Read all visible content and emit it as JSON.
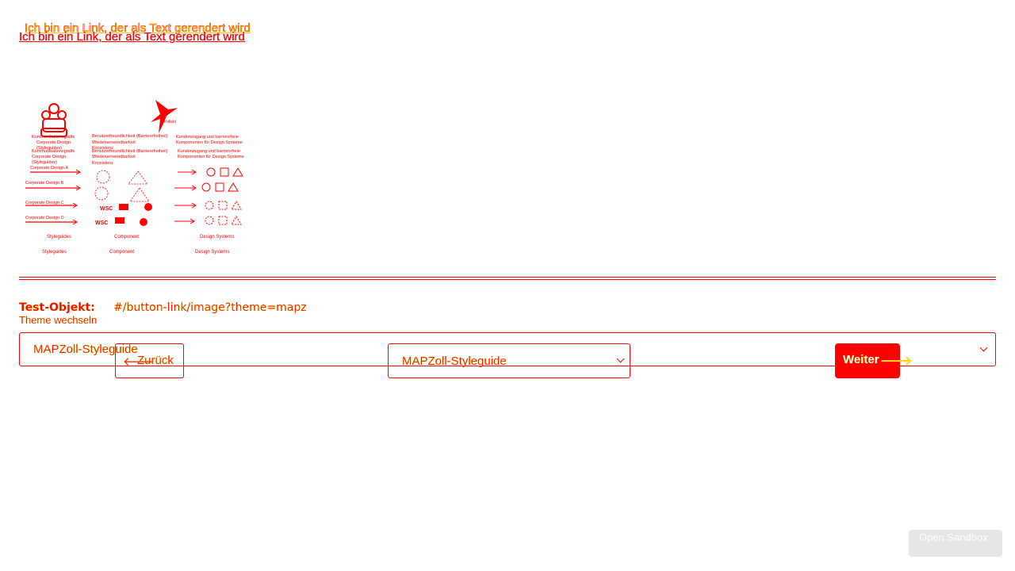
{
  "links": {
    "text_link": "Ich bin ein Link, der als Text gerendert wird"
  },
  "figure": {
    "title_hint": "Kollekt",
    "column_labels": [
      "Styleguides",
      "Component",
      "Design Systems"
    ],
    "col1_checks": [
      "Kommunikationsgrafik",
      "Corporate Design",
      "(Styleguides)"
    ],
    "col2_checks": [
      "Benutzerfreundlichkeit (Barrierefreiheit)",
      "Wiederverwendbarkeit",
      "Konsistenz"
    ],
    "col3_checks": [
      "Kundenzugang und barrierefreie",
      "Komponenten für Design Systeme"
    ],
    "corporate_labels": [
      "Corporate Design A",
      "Corporate Design B",
      "Corporate Design C",
      "Corporate Design D"
    ],
    "wsc_label": "WSC"
  },
  "test_object": {
    "label": "Test-Objekt:",
    "value": "#/button-link/image?theme=mapz"
  },
  "theme": {
    "label": "Theme wechseln",
    "selected": "MAPZoll-Styleguide"
  },
  "nav": {
    "back_label": "Zurück",
    "back_arrow": "🡐",
    "select_value": "MAPZoll-Styleguide",
    "next_label": "Weiter",
    "next_arrow": "🡒"
  },
  "sandbox": {
    "label": "Open Sandbox"
  },
  "colors": {
    "primary": "#ff0000",
    "outline": "#ffcc00",
    "background": "#ffffff",
    "sandbox_bg": "#e6e6e6"
  }
}
